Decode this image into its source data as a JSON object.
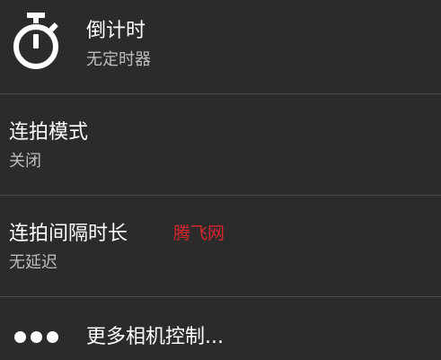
{
  "menu": {
    "timer": {
      "title": "倒计时",
      "value": "无定时器",
      "icon": "stopwatch-icon"
    },
    "burst_mode": {
      "title": "连拍模式",
      "value": "关闭"
    },
    "burst_interval": {
      "title": "连拍间隔时长",
      "value": "无延迟",
      "watermark": "腾飞网"
    },
    "more_controls": {
      "title": "更多相机控制...",
      "icon": "more-dots-icon"
    }
  },
  "colors": {
    "background": "#2b2b2b",
    "divider": "#4a4a4a",
    "primary_text": "#ffffff",
    "secondary_text": "#bdbdbd",
    "watermark": "#d4262c"
  }
}
